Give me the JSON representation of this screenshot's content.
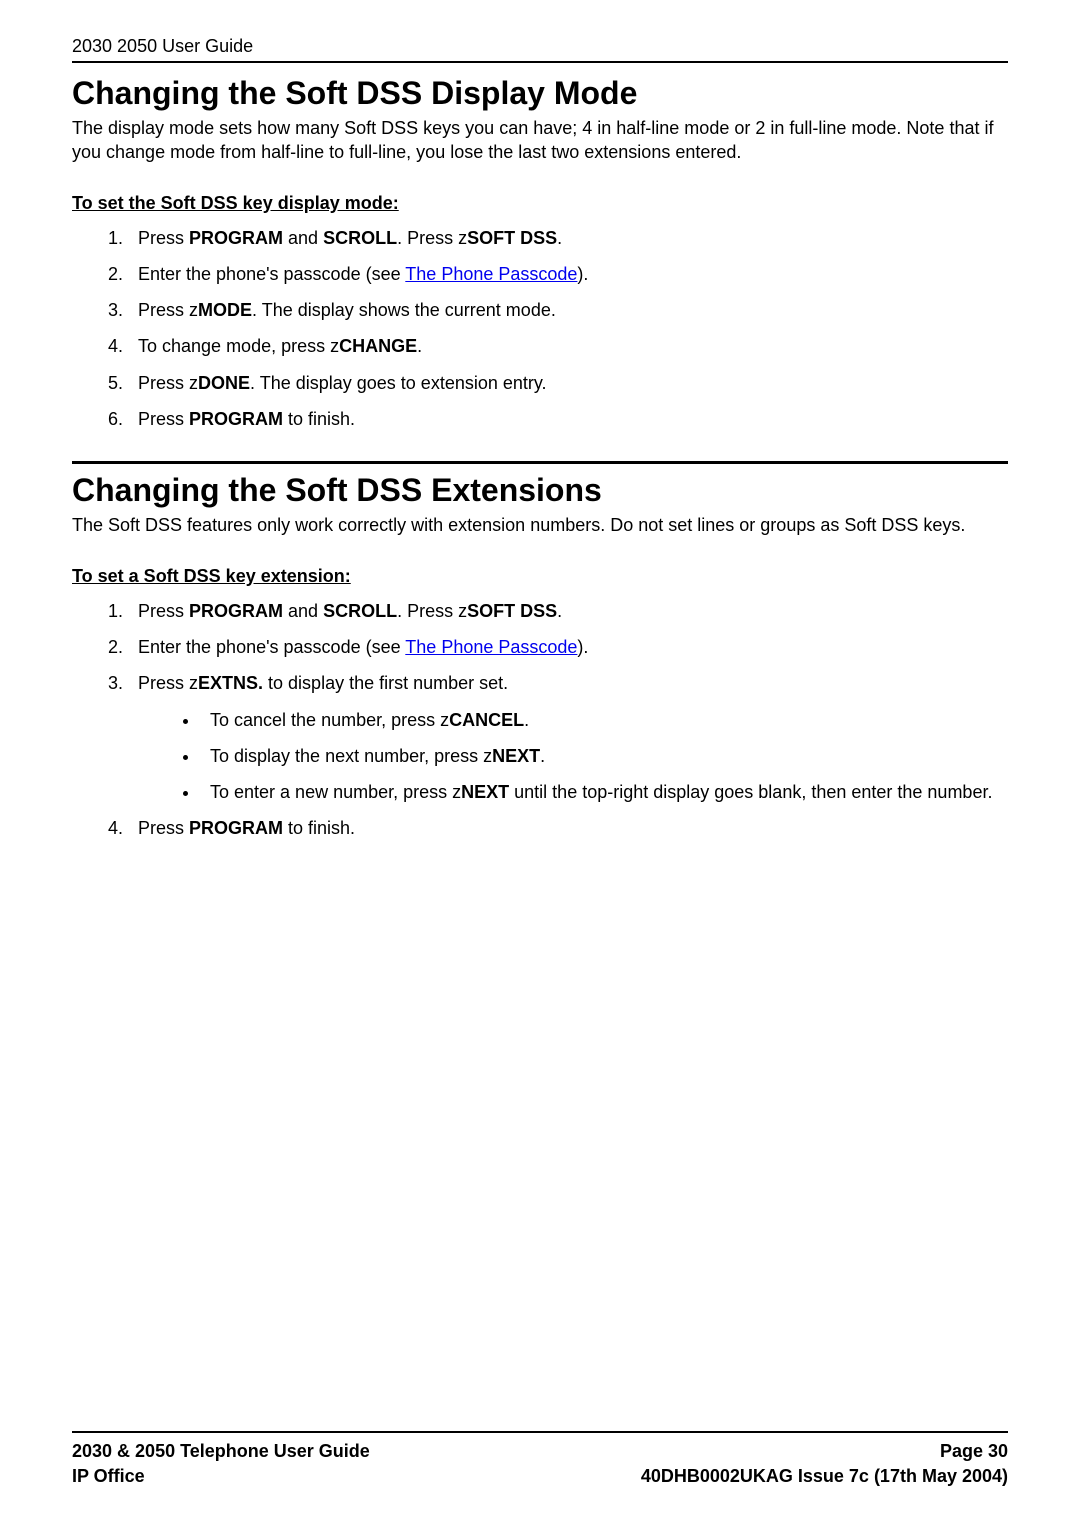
{
  "header": "2030 2050 User Guide",
  "section1": {
    "title": "Changing the Soft DSS Display Mode",
    "intro": "The display mode sets how many Soft DSS keys you can have; 4 in half-line mode or 2 in full-line mode. Note that if you change mode from half-line to full-line, you lose the last two extensions entered.",
    "subhead": "To set the Soft DSS key display mode:",
    "steps": {
      "s1": {
        "pre": "Press ",
        "b1": "PROGRAM",
        "mid1": " and ",
        "b2": "SCROLL",
        "mid2": ". Press  z",
        "b3": "SOFT DSS",
        "post": "."
      },
      "s2": {
        "pre": "Enter the phone's passcode (see ",
        "link": "The Phone Passcode",
        "post": ")."
      },
      "s3": {
        "pre": "Press  z",
        "b1": "MODE",
        "post": ". The display shows the current mode."
      },
      "s4": {
        "pre": "To change mode, press  z",
        "b1": "CHANGE",
        "post": "."
      },
      "s5": {
        "pre": "Press  z",
        "b1": "DONE",
        "post": ". The display goes to extension entry."
      },
      "s6": {
        "pre": "Press ",
        "b1": "PROGRAM",
        "post": " to finish."
      }
    }
  },
  "section2": {
    "title": "Changing the Soft DSS Extensions",
    "intro": "The Soft DSS features only work correctly with extension numbers. Do not set lines or groups as Soft DSS keys.",
    "subhead": "To set a Soft DSS key extension:",
    "steps": {
      "s1": {
        "pre": "Press ",
        "b1": "PROGRAM",
        "mid1": " and ",
        "b2": "SCROLL",
        "mid2": ". Press  z",
        "b3": "SOFT DSS",
        "post": "."
      },
      "s2": {
        "pre": "Enter the phone's passcode (see ",
        "link": "The Phone Passcode",
        "post": ")."
      },
      "s3": {
        "pre": "Press  z",
        "b1": "EXTNS.",
        "post": " to display the first number set."
      },
      "s3sub": {
        "a": {
          "pre": "To cancel the number, press  z",
          "b1": "CANCEL",
          "post": "."
        },
        "b": {
          "pre": "To display the next number, press  z",
          "b1": "NEXT",
          "post": "."
        },
        "c": {
          "pre": "To enter a new number, press  z",
          "b1": "NEXT",
          "post": " until the top-right display goes blank, then enter the number."
        }
      },
      "s4": {
        "pre": "Press ",
        "b1": "PROGRAM",
        "post": " to finish."
      }
    }
  },
  "footer": {
    "left1": "2030 & 2050 Telephone User Guide",
    "right1": "Page 30",
    "left2": "IP Office",
    "right2": "40DHB0002UKAG Issue 7c (17th May 2004)"
  }
}
